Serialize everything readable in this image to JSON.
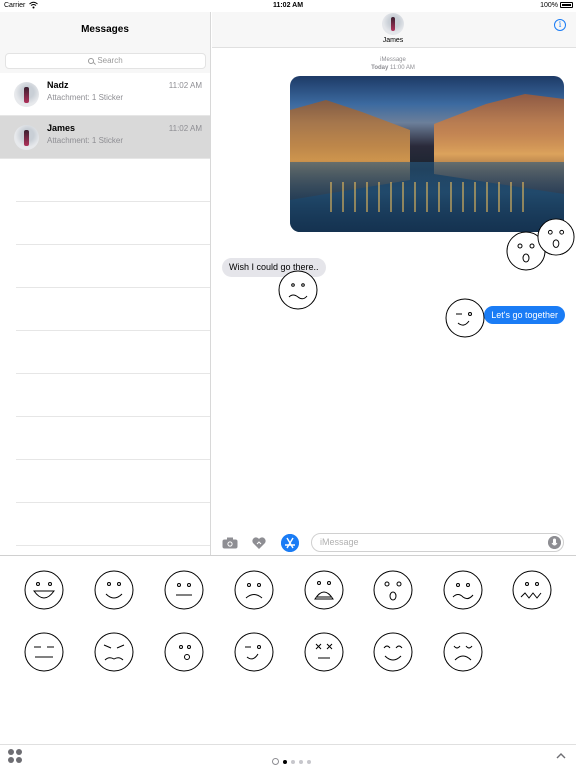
{
  "status_bar": {
    "carrier": "Carrier",
    "time": "11:02 AM",
    "battery": "100%"
  },
  "sidebar": {
    "title": "Messages",
    "search_placeholder": "Search",
    "conversations": [
      {
        "name": "Nadz",
        "preview": "Attachment: 1 Sticker",
        "time": "11:02 AM",
        "selected": false
      },
      {
        "name": "James",
        "preview": "Attachment: 1 Sticker",
        "time": "11:02 AM",
        "selected": true
      }
    ]
  },
  "thread": {
    "contact_name": "James",
    "service": "iMessage",
    "date_label": "Today",
    "time_label": "11:00 AM",
    "messages": [
      {
        "from": "them",
        "text": "Wish I could go there.."
      },
      {
        "from": "me",
        "text": "Let's go together"
      }
    ],
    "compose_placeholder": "iMessage"
  },
  "accent_color": "#1a7cf5",
  "sticker_drawer": {
    "faces": [
      "laughing",
      "smiling",
      "neutral",
      "frowning",
      "anguished",
      "surprised",
      "wavy-mouth",
      "wavy-worried",
      "expressionless",
      "annoyed",
      "small-open-mouth",
      "winking",
      "dizzy",
      "happy-closed-eyes",
      "sad-closed-eyes"
    ],
    "page_count": 4,
    "active_page": 1
  }
}
